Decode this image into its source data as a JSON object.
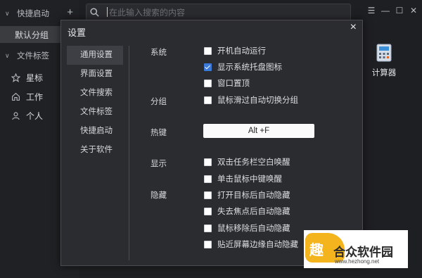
{
  "sidebar": {
    "groups": [
      {
        "label": "快捷启动",
        "add": "+"
      },
      {
        "label": "文件标签"
      }
    ],
    "default_group": "默认分组",
    "tags": [
      {
        "label": "星标",
        "icon": "star-icon"
      },
      {
        "label": "工作",
        "icon": "home-icon"
      },
      {
        "label": "个人",
        "icon": "person-icon"
      }
    ]
  },
  "search": {
    "placeholder": "在此输入搜索的内容"
  },
  "window": {
    "menu": "☰",
    "minimize": "—",
    "maximize": "☐",
    "close": "✕"
  },
  "app_tile": {
    "label": "计算器",
    "icon": "calculator-icon"
  },
  "dialog": {
    "title": "设置",
    "close": "×",
    "nav": [
      {
        "label": "通用设置",
        "active": true
      },
      {
        "label": "界面设置"
      },
      {
        "label": "文件搜索"
      },
      {
        "label": "文件标签"
      },
      {
        "label": "快捷启动"
      },
      {
        "label": "关于软件"
      }
    ],
    "sections": {
      "system": "系统",
      "group": "分组",
      "hotkey": "热键",
      "display": "显示",
      "hide": "隐藏"
    },
    "options": [
      {
        "label": "开机自动运行",
        "checked": false
      },
      {
        "label": "显示系统托盘图标",
        "checked": true
      },
      {
        "label": "窗口置顶",
        "checked": false
      },
      {
        "label": "鼠标滑过自动切换分组",
        "checked": false
      },
      {
        "label": "双击任务栏空白唤醒",
        "checked": false
      },
      {
        "label": "单击鼠标中键唤醒",
        "checked": false
      },
      {
        "label": "打开目标后自动隐藏",
        "checked": false
      },
      {
        "label": "失去焦点后自动隐藏",
        "checked": false
      },
      {
        "label": "鼠标移除后自动隐藏",
        "checked": false
      },
      {
        "label": "贴近屏幕边缘自动隐藏",
        "checked": false
      }
    ],
    "hotkey_value": "Alt +F"
  },
  "watermark": {
    "badge": "趣",
    "text": "合众软件园",
    "url": "www.hezhong.net"
  },
  "colors": {
    "accent": "#3b7ad9",
    "dialog_bg": "#2b2c30",
    "app_bg": "#1e1f22"
  }
}
